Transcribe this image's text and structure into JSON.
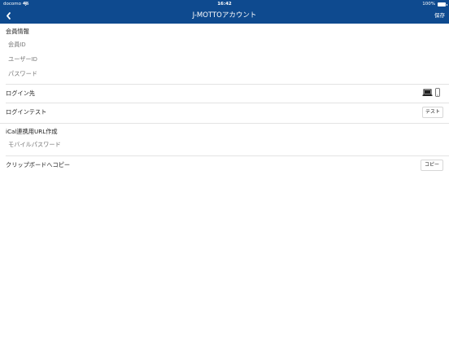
{
  "status_bar": {
    "carrier": "docomo 4G",
    "time": "16:42",
    "battery": "100%"
  },
  "nav": {
    "title": "J-MOTTOアカウント",
    "save_label": "保存"
  },
  "member_section": {
    "title": "会員情報",
    "member_id_placeholder": "会員ID",
    "user_id_placeholder": "ユーザーID",
    "password_placeholder": "パスワード"
  },
  "login_target": {
    "label": "ログイン先",
    "options": [
      "laptop-icon",
      "phone-icon"
    ]
  },
  "login_test": {
    "label": "ログインテスト",
    "button_label": "テスト"
  },
  "ical_section": {
    "title": "iCal連携用URL作成",
    "mobile_password_placeholder": "モバイルパスワード"
  },
  "clipboard": {
    "label": "クリップボードへコピー",
    "button_label": "コピー"
  },
  "colors": {
    "accent": "#0e4a8f",
    "placeholder": "#c4c4c4",
    "divider": "#e3e3e3"
  }
}
